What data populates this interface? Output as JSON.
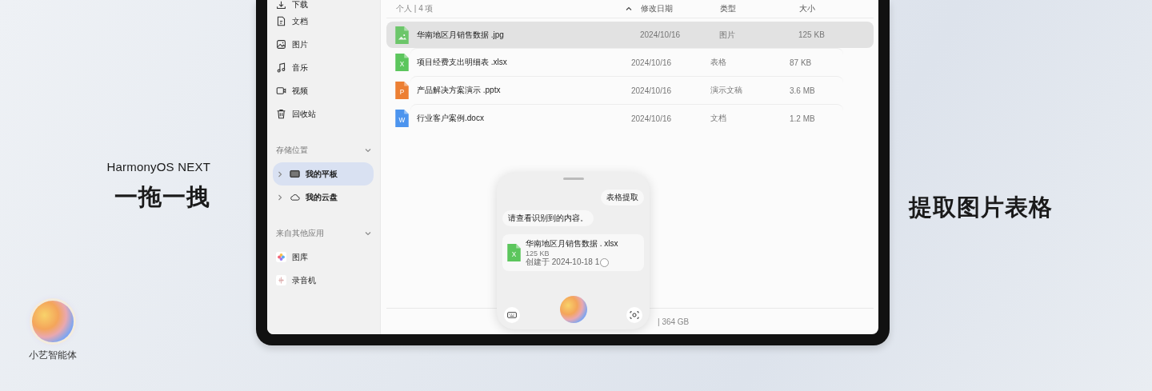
{
  "left": {
    "brand": "HarmonyOS NEXT",
    "headline": "一拖一拽",
    "assistant_label": "小艺智能体"
  },
  "right": {
    "headline": "提取图片表格"
  },
  "sidebar": {
    "items": [
      {
        "label": "下载",
        "kind": "download",
        "selected": false
      },
      {
        "label": "文档",
        "kind": "document",
        "selected": false
      },
      {
        "label": "图片",
        "kind": "image",
        "selected": false
      },
      {
        "label": "音乐",
        "kind": "music",
        "selected": false
      },
      {
        "label": "视频",
        "kind": "video",
        "selected": false
      },
      {
        "label": "回收站",
        "kind": "trash",
        "selected": false
      }
    ],
    "sections": [
      {
        "title": "存储位置",
        "expanded": true,
        "items": [
          {
            "label": "我的平板",
            "kind": "tablet",
            "selected": true,
            "expanded": false
          },
          {
            "label": "我的云盘",
            "kind": "cloud",
            "selected": false,
            "expanded": false
          }
        ]
      },
      {
        "title": "来自其他应用",
        "expanded": true,
        "items": [
          {
            "label": "图库",
            "kind": "gallery",
            "selected": false
          },
          {
            "label": "录音机",
            "kind": "recorder",
            "selected": false
          }
        ]
      }
    ]
  },
  "table": {
    "summary": "个人 | 4 项",
    "sort_ascending": true,
    "columns": [
      "修改日期",
      "类型",
      "大小"
    ],
    "rows": [
      {
        "name": "华南地区月销售数据 .jpg",
        "date": "2024/10/16",
        "type": "图片",
        "size": "125 KB",
        "kind": "image",
        "color": "#6cc66a",
        "selected": true
      },
      {
        "name": "项目经费支出明细表 .xlsx",
        "date": "2024/10/16",
        "type": "表格",
        "size": "87 KB",
        "kind": "letter",
        "letter": "X",
        "color": "#5cc65d",
        "selected": false
      },
      {
        "name": "产品解决方案演示 .pptx",
        "date": "2024/10/16",
        "type": "演示文稿",
        "size": "3.6 MB",
        "kind": "letter",
        "letter": "P",
        "color": "#ec7f33",
        "selected": false
      },
      {
        "name": "行业客户案例.docx",
        "date": "2024/10/16",
        "type": "文档",
        "size": "1.2 MB",
        "kind": "letter",
        "letter": "W",
        "color": "#4c94ee",
        "selected": false
      }
    ]
  },
  "storage": "| 364 GB",
  "assistant": {
    "messages": [
      {
        "kind": "user",
        "text": "表格提取"
      },
      {
        "kind": "assistant",
        "text": "请查看识别到的内容。"
      }
    ],
    "file": {
      "name": "华南地区月销售数据 . xlsx",
      "size": "125 KB",
      "created": "创建于 2024-10-18 1",
      "letter": "X",
      "color": "#5cc65d",
      "loading": true
    }
  }
}
